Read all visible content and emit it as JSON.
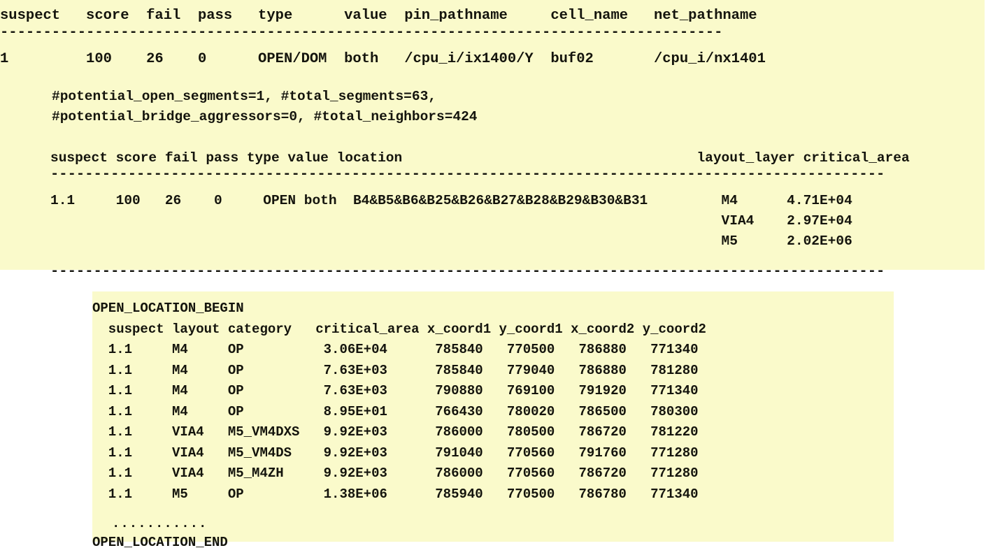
{
  "colors": {
    "panel_background": "#fafacb",
    "text": "#14140d",
    "shadow": "#b8b8b8",
    "page_background": "#ffffff"
  },
  "top_panel": {
    "suspect_table": {
      "headers": [
        "suspect",
        "score",
        "fail",
        "pass",
        "type",
        "value",
        "pin_pathname",
        "cell_name",
        "net_pathname"
      ],
      "separator": "------------------------------------------------------------------------------------",
      "header_line": "suspect   score  fail  pass   type      value  pin_pathname     cell_name   net_pathname",
      "row_line": "1         100    26    0      OPEN/DOM  both   /cpu_i/ix1400/Y  buf02       /cpu_i/nx1401",
      "rows": [
        {
          "suspect": "1",
          "score": "100",
          "fail": "26",
          "pass": "0",
          "type": "OPEN/DOM",
          "value": "both",
          "pin_pathname": "/cpu_i/ix1400/Y",
          "cell_name": "buf02",
          "net_pathname": "/cpu_i/nx1401"
        }
      ]
    },
    "stats_lines": [
      "#potential_open_segments=1, #total_segments=63,",
      "#potential_bridge_aggressors=0, #total_neighbors=424"
    ],
    "stats": {
      "potential_open_segments": "1",
      "total_segments": "63",
      "potential_bridge_aggressors": "0",
      "total_neighbors": "424"
    },
    "detail_table": {
      "headers": [
        "suspect",
        "score",
        "fail",
        "pass",
        "type",
        "value",
        "location",
        "layout_layer",
        "critical_area"
      ],
      "header_line": "suspect score fail pass type value location                                    layout_layer critical_area",
      "separator": "-------------------------------------------------------------------------------------------------",
      "row_lines": [
        "1.1     100   26    0     OPEN both  B4&B5&B6&B25&B26&B27&B28&B29&B30&B31         M4      4.71E+04",
        "                                                                                  VIA4    2.97E+04",
        "                                                                                  M5      2.02E+06"
      ],
      "rows": [
        {
          "suspect": "1.1",
          "score": "100",
          "fail": "26",
          "pass": "0",
          "type": "OPEN",
          "value": "both",
          "location": "B4&B5&B6&B25&B26&B27&B28&B29&B30&B31",
          "layout_layer": "M4",
          "critical_area": "4.71E+04"
        },
        {
          "layout_layer": "VIA4",
          "critical_area": "2.97E+04"
        },
        {
          "layout_layer": "M5",
          "critical_area": "2.02E+06"
        }
      ]
    }
  },
  "bottom_panel": {
    "begin_marker": "OPEN_LOCATION_BEGIN",
    "end_marker": "OPEN_LOCATION_END",
    "ellipsis": "...........",
    "header_line": "  suspect layout category   critical_area x_coord1 y_coord1 x_coord2 y_coord2",
    "headers": [
      "suspect",
      "layout",
      "category",
      "critical_area",
      "x_coord1",
      "y_coord1",
      "x_coord2",
      "y_coord2"
    ],
    "row_lines": [
      "  1.1     M4     OP          3.06E+04      785840   770500   786880   771340",
      "  1.1     M4     OP          7.63E+03      785840   779040   786880   781280",
      "  1.1     M4     OP          7.63E+03      790880   769100   791920   771340",
      "  1.1     M4     OP          8.95E+01      766430   780020   786500   780300",
      "  1.1     VIA4   M5_VM4DXS   9.92E+03      786000   780500   786720   781220",
      "  1.1     VIA4   M5_VM4DS    9.92E+03      791040   770560   791760   771280",
      "  1.1     VIA4   M5_M4ZH     9.92E+03      786000   770560   786720   771280",
      "  1.1     M5     OP          1.38E+06      785940   770500   786780   771340"
    ],
    "rows": [
      {
        "suspect": "1.1",
        "layout": "M4",
        "category": "OP",
        "critical_area": "3.06E+04",
        "x_coord1": "785840",
        "y_coord1": "770500",
        "x_coord2": "786880",
        "y_coord2": "771340"
      },
      {
        "suspect": "1.1",
        "layout": "M4",
        "category": "OP",
        "critical_area": "7.63E+03",
        "x_coord1": "785840",
        "y_coord1": "779040",
        "x_coord2": "786880",
        "y_coord2": "781280"
      },
      {
        "suspect": "1.1",
        "layout": "M4",
        "category": "OP",
        "critical_area": "7.63E+03",
        "x_coord1": "790880",
        "y_coord1": "769100",
        "x_coord2": "791920",
        "y_coord2": "771340"
      },
      {
        "suspect": "1.1",
        "layout": "M4",
        "category": "OP",
        "critical_area": "8.95E+01",
        "x_coord1": "766430",
        "y_coord1": "780020",
        "x_coord2": "786500",
        "y_coord2": "780300"
      },
      {
        "suspect": "1.1",
        "layout": "VIA4",
        "category": "M5_VM4DXS",
        "critical_area": "9.92E+03",
        "x_coord1": "786000",
        "y_coord1": "780500",
        "x_coord2": "786720",
        "y_coord2": "781220"
      },
      {
        "suspect": "1.1",
        "layout": "VIA4",
        "category": "M5_VM4DS",
        "critical_area": "9.92E+03",
        "x_coord1": "791040",
        "y_coord1": "770560",
        "x_coord2": "791760",
        "y_coord2": "771280"
      },
      {
        "suspect": "1.1",
        "layout": "VIA4",
        "category": "M5_M4ZH",
        "critical_area": "9.92E+03",
        "x_coord1": "786000",
        "y_coord1": "770560",
        "x_coord2": "786720",
        "y_coord2": "771280"
      },
      {
        "suspect": "1.1",
        "layout": "M5",
        "category": "OP",
        "critical_area": "1.38E+06",
        "x_coord1": "785940",
        "y_coord1": "770500",
        "x_coord2": "786780",
        "y_coord2": "771340"
      }
    ]
  }
}
